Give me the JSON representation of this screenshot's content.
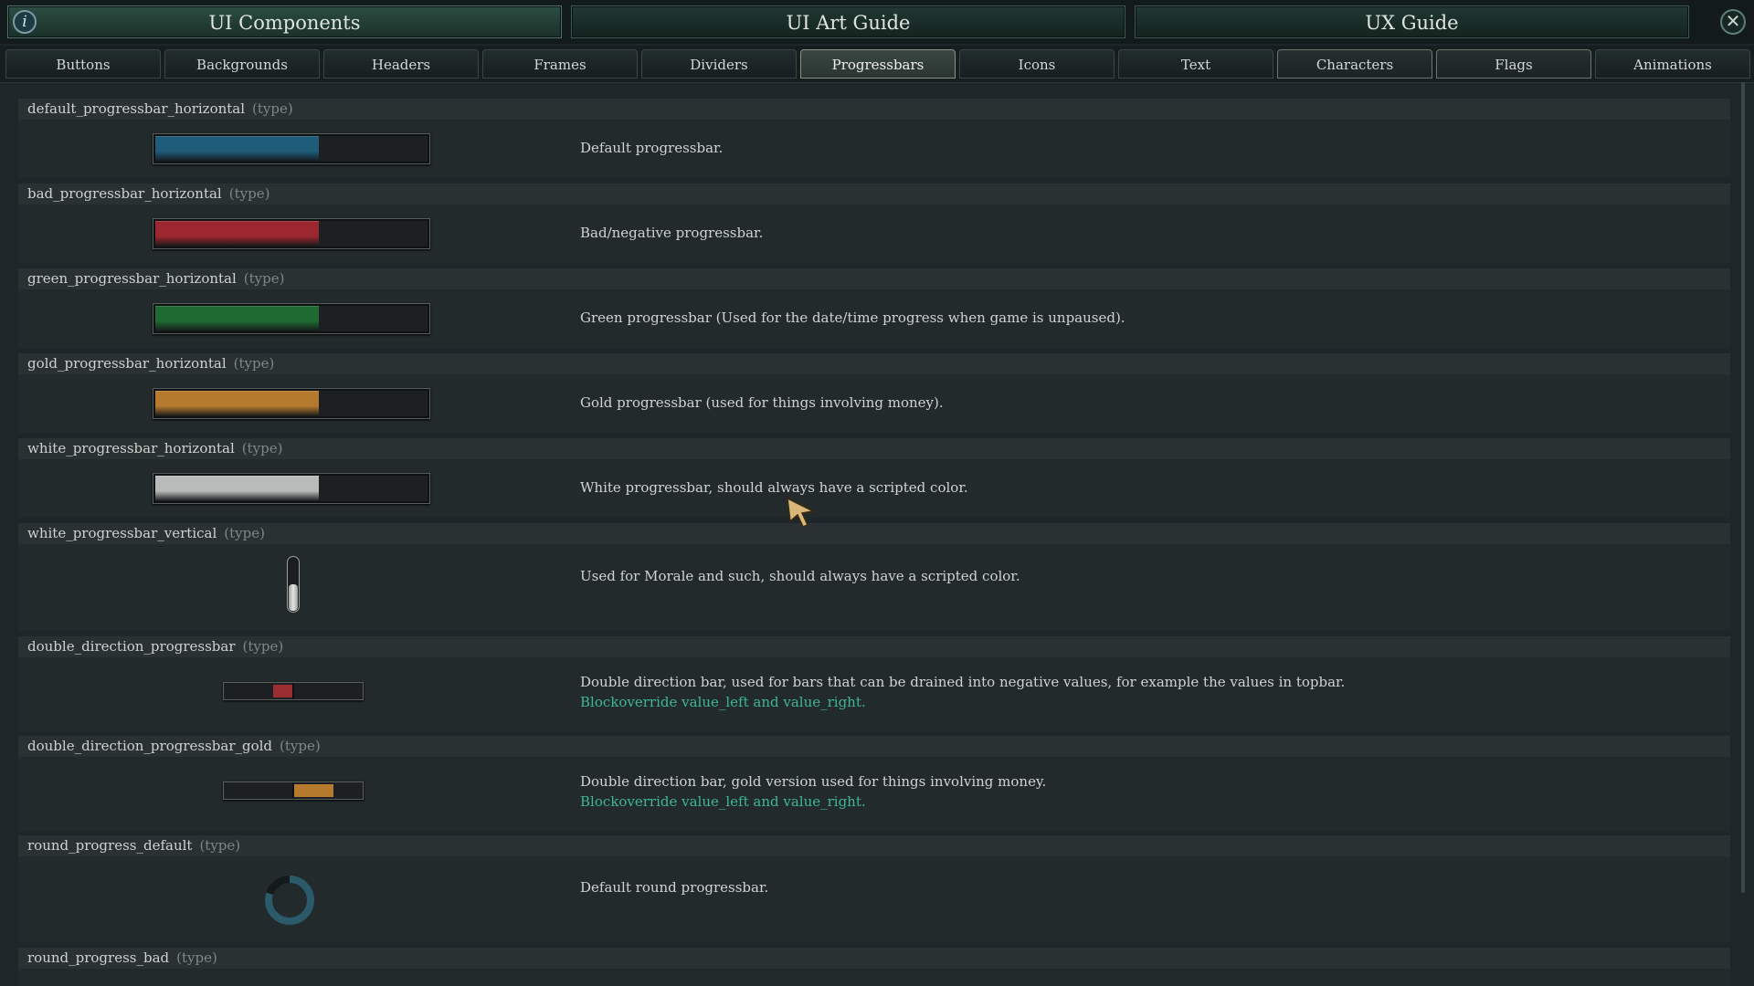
{
  "top_tabs": [
    {
      "label": "UI Components"
    },
    {
      "label": "UI Art Guide"
    },
    {
      "label": "UX Guide"
    }
  ],
  "icons": {
    "info": "info-icon",
    "close": "close-icon",
    "cursor": "arrow-cursor-icon"
  },
  "info_glyph": "i",
  "close_glyph": "✕",
  "sub_tabs": [
    {
      "label": "Buttons"
    },
    {
      "label": "Backgrounds"
    },
    {
      "label": "Headers"
    },
    {
      "label": "Frames"
    },
    {
      "label": "Dividers"
    },
    {
      "label": "Progressbars"
    },
    {
      "label": "Icons"
    },
    {
      "label": "Text"
    },
    {
      "label": "Characters"
    },
    {
      "label": "Flags"
    },
    {
      "label": "Animations"
    }
  ],
  "active_sub_tab": "Progressbars",
  "entries": [
    {
      "name": "default_progressbar_horizontal",
      "type": "(type)",
      "description": "Default progressbar.",
      "fill": 0.6,
      "color": "#1f5c7a"
    },
    {
      "name": "bad_progressbar_horizontal",
      "type": "(type)",
      "description": "Bad/negative progressbar.",
      "fill": 0.6,
      "color": "#9c2730"
    },
    {
      "name": "green_progressbar_horizontal",
      "type": "(type)",
      "description": "Green progressbar (Used for the date/time progress when game is unpaused).",
      "fill": 0.6,
      "color": "#1f6a32"
    },
    {
      "name": "gold_progressbar_horizontal",
      "type": "(type)",
      "description": "Gold progressbar (used for things involving money).",
      "fill": 0.6,
      "color": "#b57a2e"
    },
    {
      "name": "white_progressbar_horizontal",
      "type": "(type)",
      "description": "White progressbar, should always have a scripted color.",
      "fill": 0.6,
      "color": "#b9bbba"
    },
    {
      "name": "white_progressbar_vertical",
      "type": "(type)",
      "description": "Used for Morale and such, should always have a scripted color.",
      "fill": 0.5,
      "color": "#d6d8d6"
    },
    {
      "name": "double_direction_progressbar",
      "type": "(type)",
      "description": "Double direction bar, used for bars that can be drained into negative values, for example the values in topbar.",
      "highlight": "Blockoverride value_left and value_right.",
      "fill": -0.3,
      "color": "#9a2d31"
    },
    {
      "name": "double_direction_progressbar_gold",
      "type": "(type)",
      "description": "Double direction bar, gold version used for things involving money.",
      "highlight": "Blockoverride value_left and value_right.",
      "fill": 0.6,
      "color": "#b57a2e"
    },
    {
      "name": "round_progress_default",
      "type": "(type)",
      "description": "Default round progressbar.",
      "fill": 0.8,
      "color": "#2b5a6a"
    },
    {
      "name": "round_progress_bad",
      "type": "(type)"
    }
  ],
  "colors": {
    "accent_highlight": "#3fb69a",
    "header_bg": "#2a3132",
    "body_bg": "#222a2c"
  }
}
